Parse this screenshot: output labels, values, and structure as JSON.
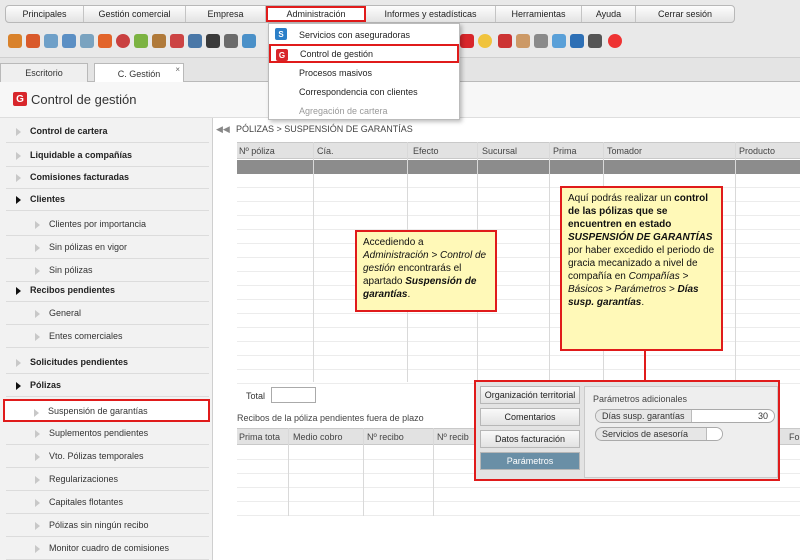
{
  "menubar": {
    "items": [
      "Principales",
      "Gestión comercial",
      "Empresa",
      "Administración",
      "Informes y estadísticas",
      "Herramientas",
      "Ayuda",
      "Cerrar sesión"
    ]
  },
  "dropdown": {
    "items": [
      "Servicios con aseguradoras",
      "Control de gestión",
      "Procesos masivos",
      "Correspondencia con clientes",
      "Agregación de cartera"
    ]
  },
  "tabs": [
    "Escritorio",
    "C. Gestión"
  ],
  "page_title": "Control de gestión",
  "sidebar": {
    "items": [
      "Control de cartera",
      "Liquidable a compañías",
      "Comisiones facturadas",
      "Clientes",
      "Clientes por importancia",
      "Sin pólizas en vigor",
      "Sin pólizas",
      "Recibos pendientes",
      "General",
      "Entes comerciales",
      "Solicitudes pendientes",
      "Pólizas",
      "Suspensión de garantías",
      "Suplementos pendientes",
      "Vto. Pólizas temporales",
      "Regularizaciones",
      "Capitales flotantes",
      "Pólizas sin ningún recibo",
      "Monitor cuadro de comisiones"
    ]
  },
  "breadcrumb": "PÓLIZAS > SUSPENSIÓN DE GARANTÍAS",
  "grid1": {
    "columns": [
      "Nº póliza",
      "Cía.",
      "Efecto",
      "Sucursal",
      "Prima",
      "Tomador",
      "Producto"
    ]
  },
  "total_label": "Total",
  "grid2": {
    "title": "Recibos de la póliza pendientes fuera de plazo",
    "columns": [
      "Prima tota",
      "Medio cobro",
      "Nº recibo",
      "Nº recib",
      "Fo"
    ]
  },
  "callout1": {
    "p1": "Accediendo a ",
    "i1": "Administración > Control de gestión",
    "p2": " encontrarás el apartado ",
    "b1": "Suspensión de garantías",
    "p3": "."
  },
  "callout2": {
    "p1": "Aquí podrás realizar un ",
    "b1": "control de las pólizas que se encuentren en estado ",
    "bi1": "SUSPENSIÓN DE GARANTÍAS",
    "p2": " por haber excedido el periodo de gracia mecanizado a nivel de compañía en ",
    "i1": "Compañías > Básicos > Parámetros >",
    "bi2": "Días susp. garantías",
    "p3": "."
  },
  "params": {
    "buttons": [
      "Organización territorial",
      "Comentarios",
      "Datos facturación",
      "Parámetros"
    ],
    "section_title": "Parámetros adicionales",
    "dias_label": "Días susp. garantías",
    "dias_value": "30",
    "servicios_label": "Servicios de asesoría"
  }
}
